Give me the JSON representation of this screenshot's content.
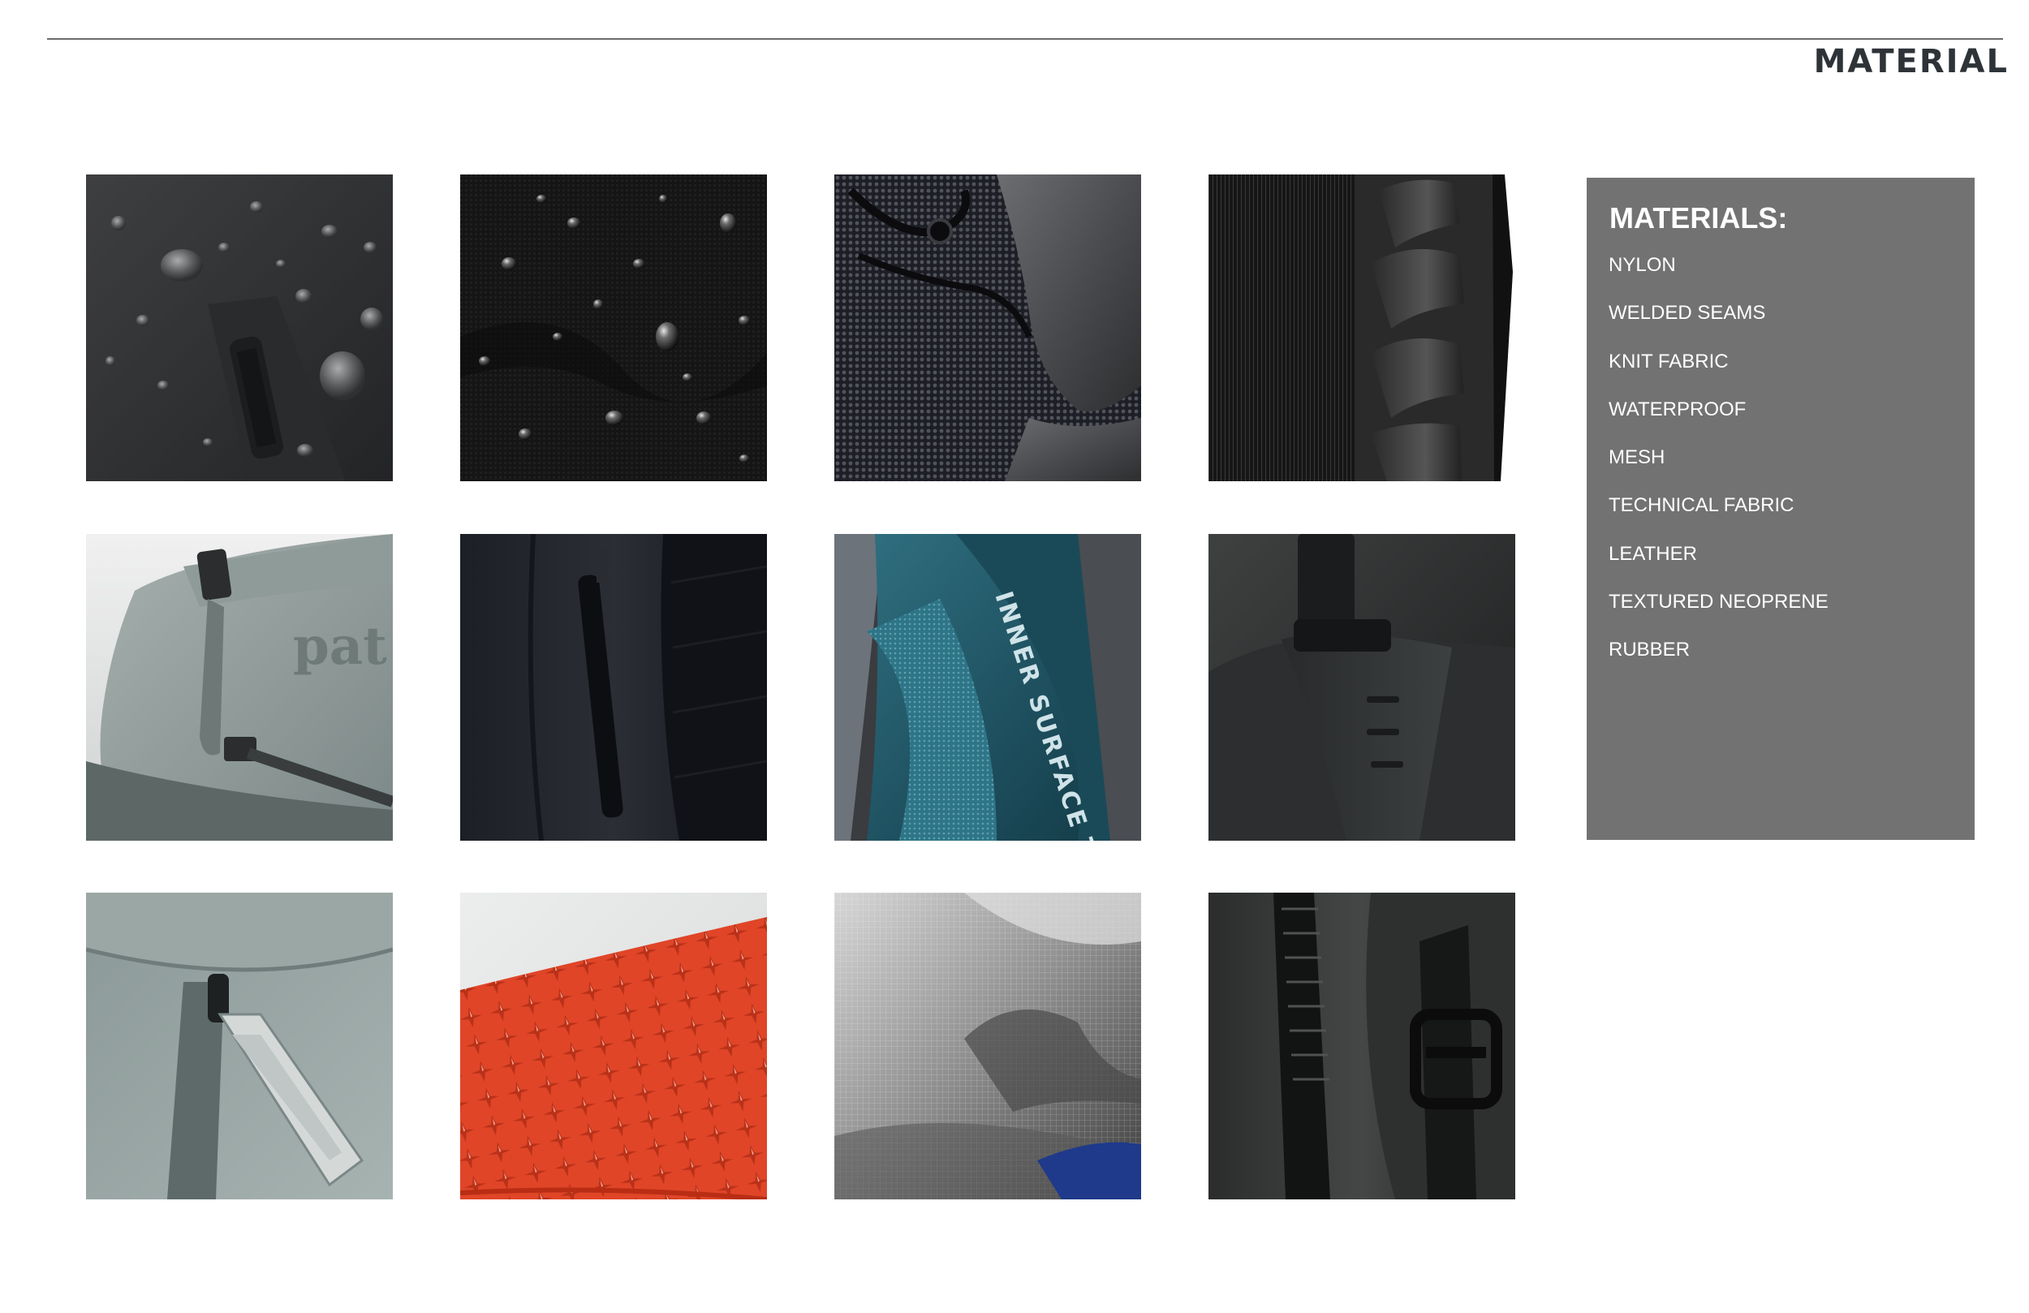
{
  "page": {
    "heading": "MATERIAL"
  },
  "swatches": [
    {
      "icon": "nylon-water-droplets-zipper-pull"
    },
    {
      "icon": "black-nylon-water-beads"
    },
    {
      "icon": "knit-fabric-with-laces"
    },
    {
      "icon": "molded-back-panel"
    },
    {
      "icon": "grey-roll-top-bag"
    },
    {
      "icon": "black-jacket-zip-pull"
    },
    {
      "icon": "inner-surface-technology-lining"
    },
    {
      "icon": "black-strap-loop"
    },
    {
      "icon": "grey-zipper-pull"
    },
    {
      "icon": "red-textured-neoprene"
    },
    {
      "icon": "silver-mesh-fabric"
    },
    {
      "icon": "black-waterproof-zipper-buckle"
    }
  ],
  "photo_text": {
    "brand_print": "pat",
    "lining_print": "INNER SURFACE TECHN"
  },
  "materials_panel": {
    "title": "MATERIALS:",
    "items": [
      "NYLON",
      "WELDED SEAMS",
      "KNIT FABRIC",
      "WATERPROOF",
      "MESH",
      "TECHNICAL FABRIC",
      "LEATHER",
      "TEXTURED NEOPRENE",
      "RUBBER"
    ]
  },
  "colors": {
    "heading": "#2e3338",
    "rule": "#6c6c6c",
    "panel_background": "#727272",
    "panel_text": "#ffffff"
  }
}
